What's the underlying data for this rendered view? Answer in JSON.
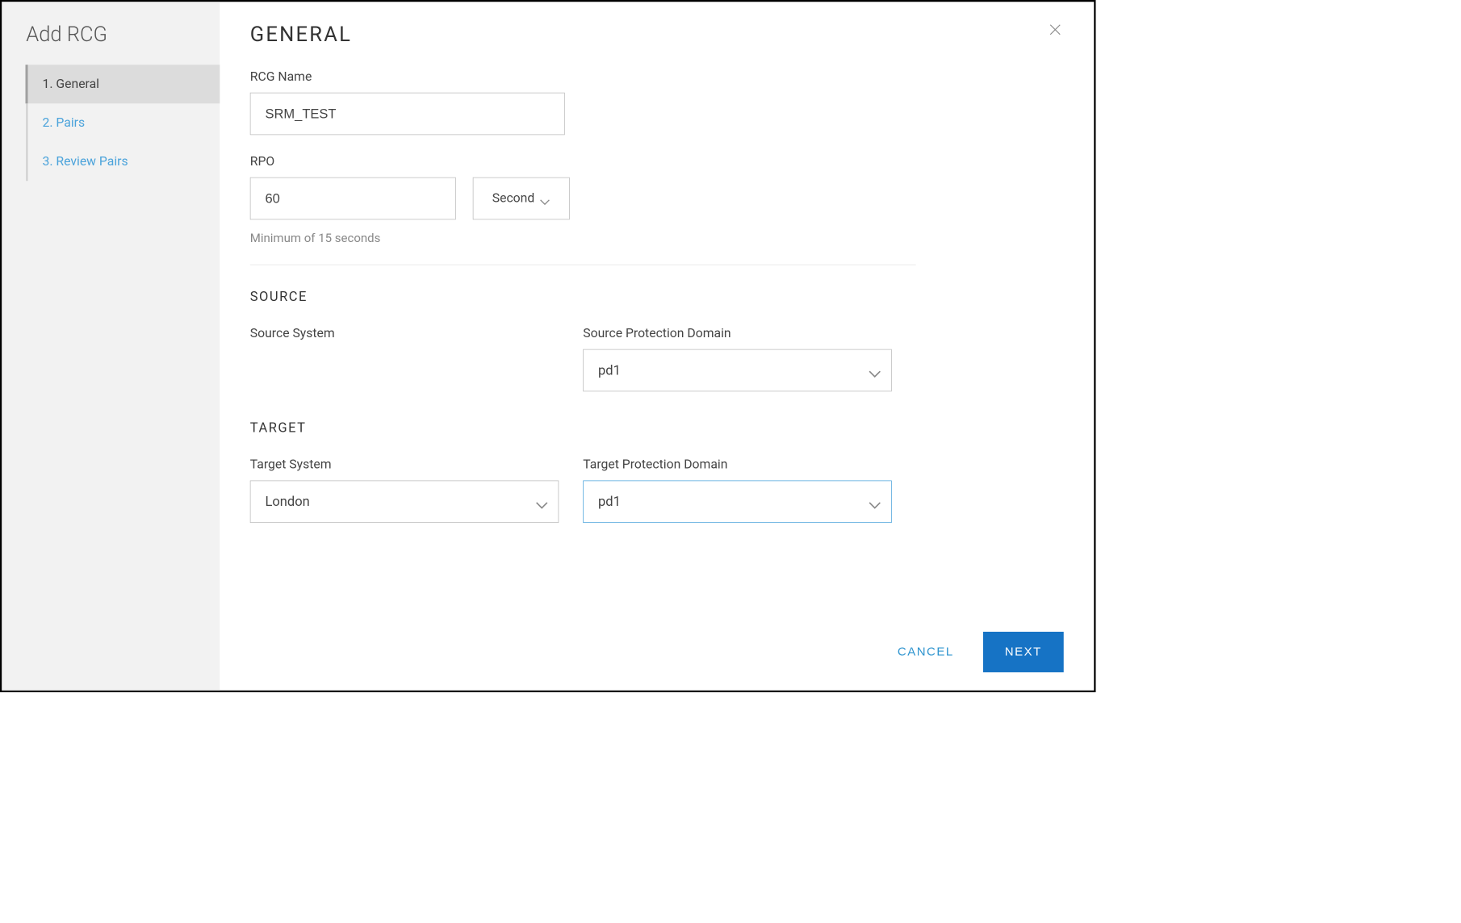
{
  "sidebar": {
    "title": "Add RCG",
    "steps": [
      {
        "label": "1. General",
        "active": true
      },
      {
        "label": "2. Pairs",
        "active": false
      },
      {
        "label": "3. Review Pairs",
        "active": false
      }
    ]
  },
  "main": {
    "title": "GENERAL",
    "rcg_name": {
      "label": "RCG Name",
      "value": "SRM_TEST"
    },
    "rpo": {
      "label": "RPO",
      "value": "60",
      "unit": "Second",
      "hint": "Minimum of 15 seconds"
    },
    "source": {
      "title": "SOURCE",
      "system_label": "Source System",
      "domain_label": "Source Protection Domain",
      "domain_value": "pd1"
    },
    "target": {
      "title": "TARGET",
      "system_label": "Target System",
      "system_value": "London",
      "domain_label": "Target Protection Domain",
      "domain_value": "pd1"
    },
    "footer": {
      "cancel": "CANCEL",
      "next": "NEXT"
    }
  }
}
